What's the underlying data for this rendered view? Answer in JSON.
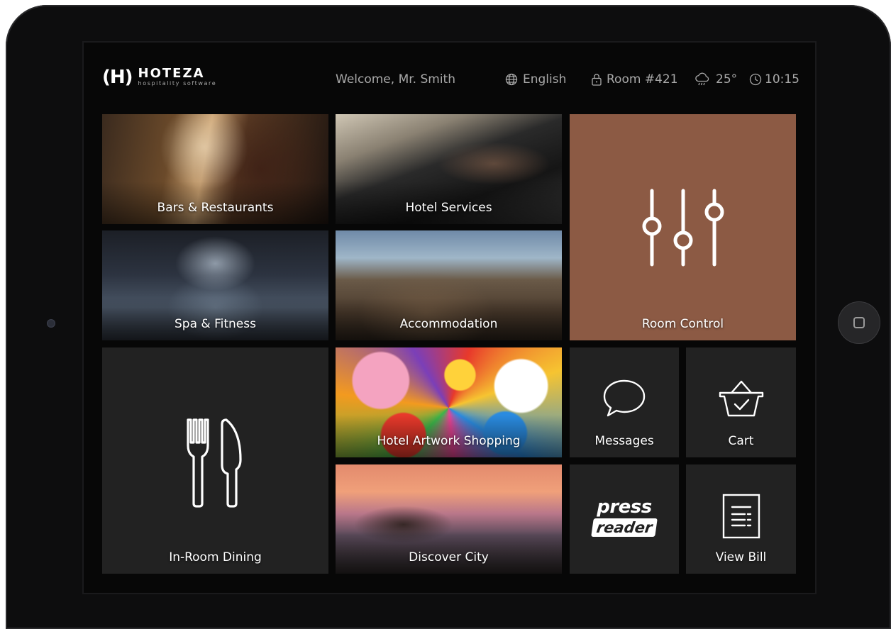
{
  "brand": {
    "mark": "(H)",
    "name": "HOTEZA",
    "tagline": "hospitality software"
  },
  "header": {
    "welcome": "Welcome, Mr. Smith",
    "language": "English",
    "room": "Room #421",
    "weather": "25°",
    "time": "10:15"
  },
  "icons": {
    "language": "globe-icon",
    "room": "lock-icon",
    "weather": "cloud-rain-icon",
    "time": "clock-icon"
  },
  "colors": {
    "accent": "#8c5a44",
    "tile": "#222222",
    "screen": "#070707"
  },
  "tiles": {
    "bars": "Bars & Restaurants",
    "services": "Hotel Services",
    "room_control": "Room Control",
    "spa": "Spa & Fitness",
    "accommodation": "Accommodation",
    "dining": "In-Room Dining",
    "artwork": "Hotel Artwork Shopping",
    "messages": "Messages",
    "cart": "Cart",
    "discover": "Discover City",
    "pressreader_top": "press",
    "pressreader_bottom": "reader",
    "bill": "View Bill"
  }
}
